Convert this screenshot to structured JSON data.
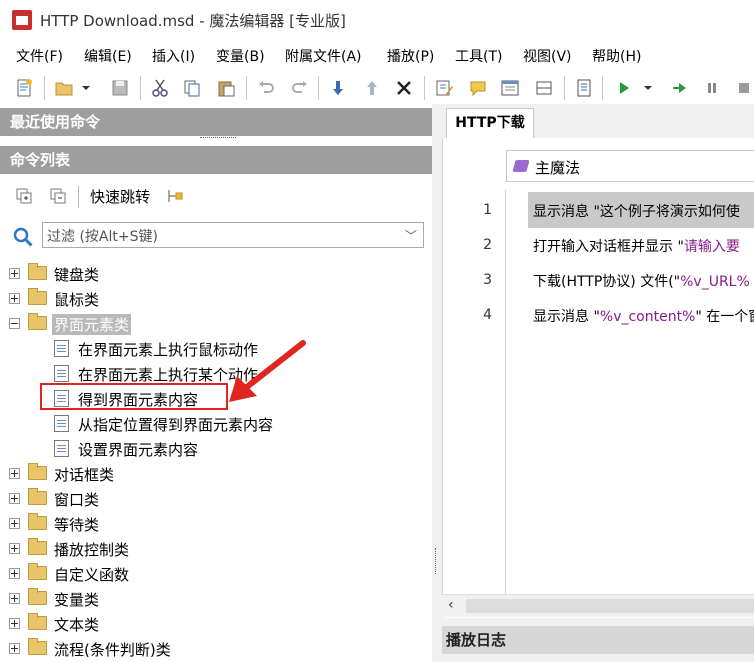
{
  "window": {
    "title": "HTTP Download.msd - 魔法编辑器 [专业版]"
  },
  "menu": [
    "文件(F)",
    "编辑(E)",
    "插入(I)",
    "变量(B)",
    "附属文件(A)",
    "播放(P)",
    "工具(T)",
    "视图(V)",
    "帮助(H)"
  ],
  "toolbar": {
    "icons": [
      "new-icon",
      "open-icon",
      "dropdown-arrow-icon",
      "save-icon",
      "cut-icon",
      "copy-icon",
      "paste-icon",
      "undo-icon",
      "redo-icon",
      "move-down-icon",
      "move-up-icon",
      "delete-icon",
      "edit-icon",
      "comment-icon",
      "window-icon",
      "panel-icon",
      "step-icon",
      "play-icon",
      "play-dropdown-icon",
      "step-over-icon",
      "pause-icon",
      "stop-icon"
    ]
  },
  "left_panel": {
    "recent_header": "最近使用命令",
    "commands_header": "命令列表",
    "quick_jump": "快速跳转",
    "filter_placeholder": "过滤 (按Alt+S键)",
    "tree": [
      {
        "label": "键盘类",
        "expanded": false
      },
      {
        "label": "鼠标类",
        "expanded": false
      },
      {
        "label": "界面元素类",
        "expanded": true,
        "selected": true,
        "children": [
          "在界面元素上执行鼠标动作",
          "在界面元素上执行某个动作",
          "得到界面元素内容",
          "从指定位置得到界面元素内容",
          "设置界面元素内容"
        ]
      },
      {
        "label": "对话框类",
        "expanded": false
      },
      {
        "label": "窗口类",
        "expanded": false
      },
      {
        "label": "等待类",
        "expanded": false
      },
      {
        "label": "播放控制类",
        "expanded": false
      },
      {
        "label": "自定义函数",
        "expanded": false
      },
      {
        "label": "变量类",
        "expanded": false
      },
      {
        "label": "文本类",
        "expanded": false
      },
      {
        "label": "流程(条件判断)类",
        "expanded": false
      }
    ],
    "highlighted_child": "得到界面元素内容"
  },
  "editor": {
    "tab": "HTTP下载",
    "procedure": "主魔法",
    "lines": [
      {
        "no": "1",
        "parts": [
          {
            "t": "显示消息 \"这个例子将演示如何使"
          }
        ]
      },
      {
        "no": "2",
        "parts": [
          {
            "t": "打开输入对话框并显示 \""
          },
          {
            "t": "请输入要",
            "s": true
          }
        ]
      },
      {
        "no": "3",
        "parts": [
          {
            "t": "下载(HTTP协议) 文件(\""
          },
          {
            "t": "%v_URL%",
            "s": true
          }
        ]
      },
      {
        "no": "4",
        "parts": [
          {
            "t": "显示消息 \""
          },
          {
            "t": "%v_content%",
            "s": true
          },
          {
            "t": "\" 在一个窗"
          }
        ]
      }
    ],
    "log_header": "播放日志"
  },
  "colors": {
    "accent_red": "#e0251f",
    "header_gray": "#9e9e9e",
    "string_purple": "#8b1a8b"
  }
}
